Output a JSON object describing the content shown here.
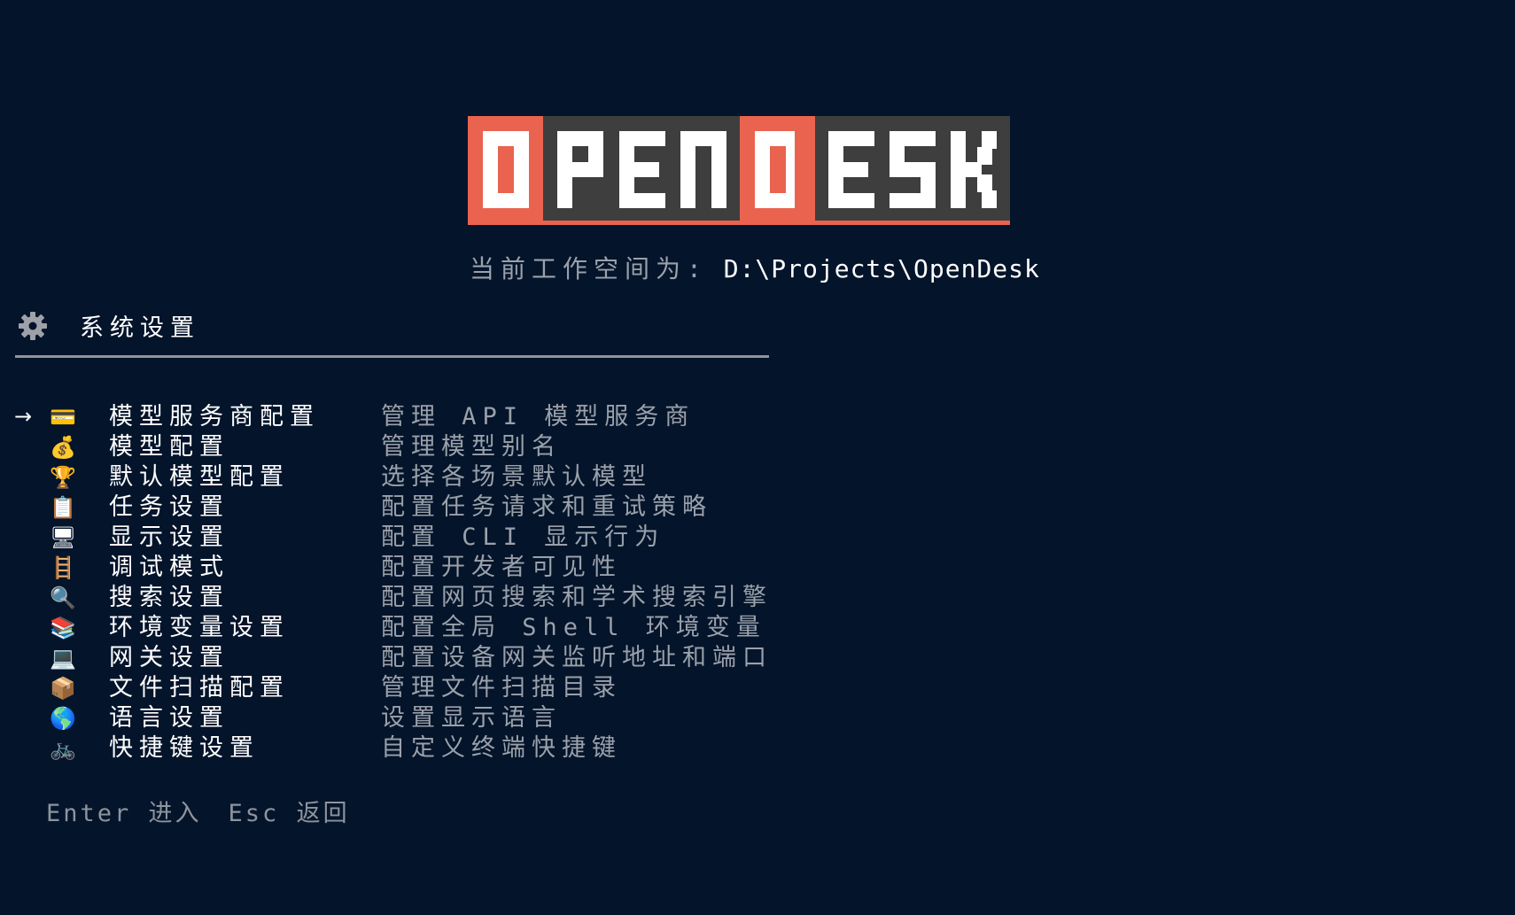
{
  "logo": {
    "text": "OPENDESK",
    "colors": {
      "red": "#e9634f",
      "grey": "#3e3e3e",
      "letter": "#ffffff"
    }
  },
  "workspace": {
    "label": "当前工作空间为:",
    "path": "D:\\Projects\\OpenDesk"
  },
  "section": {
    "icon": "gear-icon",
    "title": "系统设置"
  },
  "selected_index": 0,
  "menu": [
    {
      "icon": "credit-card-icon",
      "glyph": "💳",
      "label": "模型服务商配置",
      "desc": "管理 API 模型服务商"
    },
    {
      "icon": "money-bag-icon",
      "glyph": "💰",
      "label": "模型配置",
      "desc": "管理模型别名"
    },
    {
      "icon": "trophy-icon",
      "glyph": "🏆",
      "label": "默认模型配置",
      "desc": "选择各场景默认模型"
    },
    {
      "icon": "clipboard-icon",
      "glyph": "📋",
      "label": "任务设置",
      "desc": "配置任务请求和重试策略"
    },
    {
      "icon": "monitor-icon",
      "glyph": "🖥",
      "label": "显示设置",
      "desc": "配置 CLI 显示行为"
    },
    {
      "icon": "ladder-icon",
      "glyph": "🪜",
      "label": "调试模式",
      "desc": "配置开发者可见性"
    },
    {
      "icon": "magnifier-icon",
      "glyph": "🔍",
      "label": "搜索设置",
      "desc": "配置网页搜索和学术搜索引擎"
    },
    {
      "icon": "books-icon",
      "glyph": "📚",
      "label": "环境变量设置",
      "desc": "配置全局 Shell 环境变量"
    },
    {
      "icon": "laptop-icon",
      "glyph": "💻",
      "label": "网关设置",
      "desc": "配置设备网关监听地址和端口"
    },
    {
      "icon": "package-icon",
      "glyph": "📦",
      "label": "文件扫描配置",
      "desc": "管理文件扫描目录"
    },
    {
      "icon": "globe-icon",
      "glyph": "🌎",
      "label": "语言设置",
      "desc": "设置显示语言"
    },
    {
      "icon": "bicycle-icon",
      "glyph": "🚲",
      "label": "快捷键设置",
      "desc": "自定义终端快捷键"
    }
  ],
  "cursor_glyph": "→",
  "footer": {
    "enter_hint": "Enter 进入",
    "esc_hint": "Esc 返回"
  }
}
